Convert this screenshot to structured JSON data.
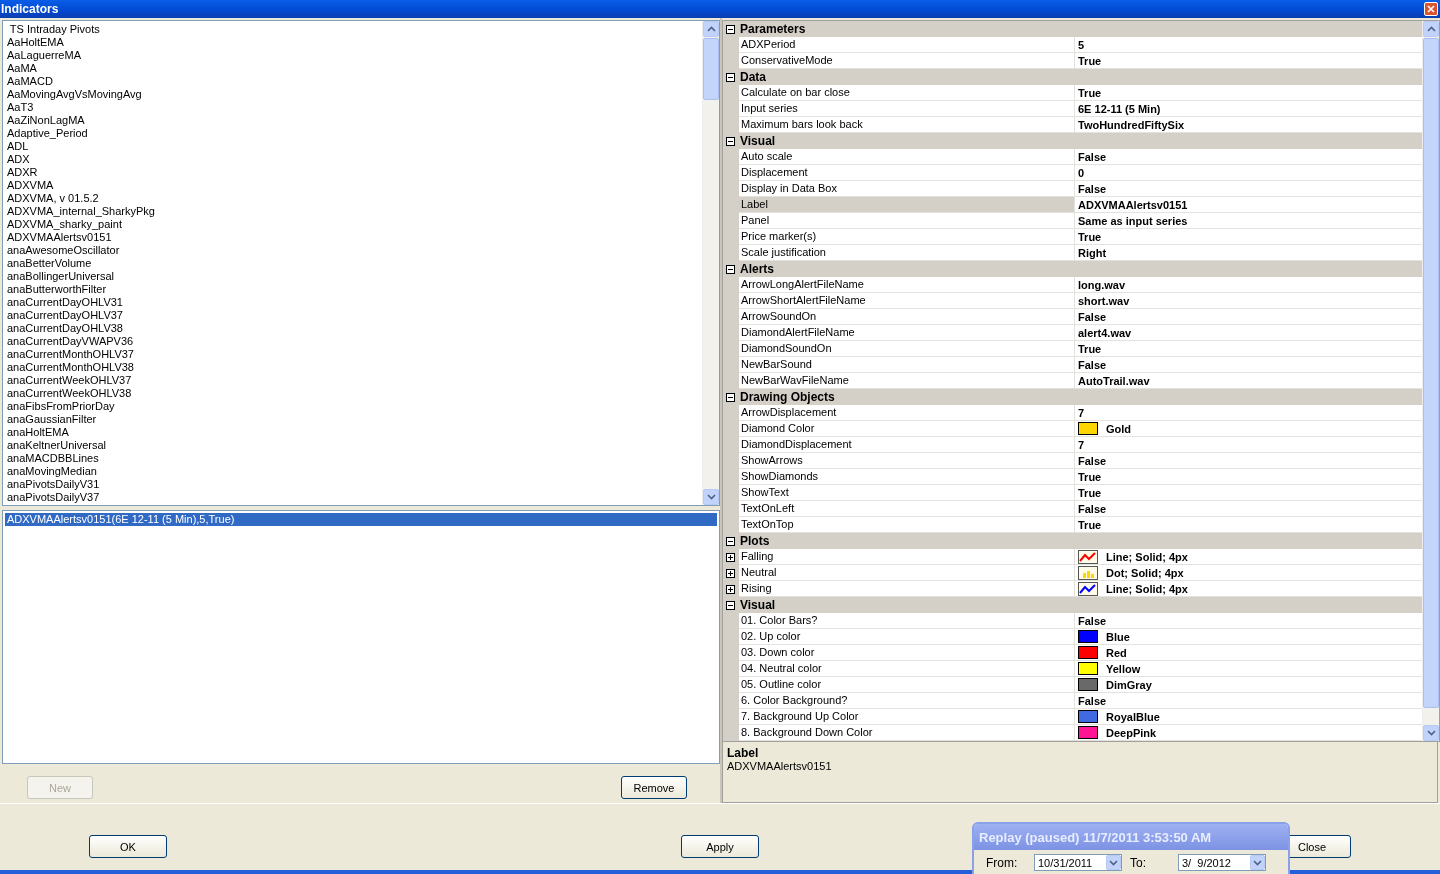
{
  "window": {
    "title": "Indicators"
  },
  "indicator_list": {
    "items": [
      " TS Intraday Pivots",
      "AaHoltEMA",
      "AaLaguerreMA",
      "AaMA",
      "AaMACD",
      "AaMovingAvgVsMovingAvg",
      "AaT3",
      "AaZiNonLagMA",
      "Adaptive_Period",
      "ADL",
      "ADX",
      "ADXR",
      "ADXVMA",
      "ADXVMA, v 01.5.2",
      "ADXVMA_internal_SharkyPkg",
      "ADXVMA_sharky_paint",
      "ADXVMAAlertsv0151",
      "anaAwesomeOscillator",
      "anaBetterVolume",
      "anaBollingerUniversal",
      "anaButterworthFilter",
      "anaCurrentDayOHLV31",
      "anaCurrentDayOHLV37",
      "anaCurrentDayOHLV38",
      "anaCurrentDayVWAPV36",
      "anaCurrentMonthOHLV37",
      "anaCurrentMonthOHLV38",
      "anaCurrentWeekOHLV37",
      "anaCurrentWeekOHLV38",
      "anaFibsFromPriorDay",
      "anaGaussianFilter",
      "anaHoltEMA",
      "anaKeltnerUniversal",
      "anaMACDBBLines",
      "anaMovingMedian",
      "anaPivotsDailyV31",
      "anaPivotsDailyV37"
    ]
  },
  "configured_list": {
    "items": [
      {
        "label": "ADXVMAAlertsv0151(6E 12-11 (5 Min),5,True)",
        "selected": true
      }
    ]
  },
  "list_buttons": [
    {
      "label": "New",
      "disabled": true
    },
    {
      "label": "Remove",
      "disabled": false
    }
  ],
  "properties": {
    "categories": [
      {
        "name": "Parameters",
        "expanded": true,
        "rows": [
          {
            "kind": "text",
            "name": "ADXPeriod",
            "value": "5",
            "selected": false
          },
          {
            "kind": "text",
            "name": "ConservativeMode",
            "value": "True",
            "selected": false
          }
        ]
      },
      {
        "name": "Data",
        "expanded": true,
        "rows": [
          {
            "kind": "text",
            "name": "Calculate on bar close",
            "value": "True",
            "selected": false
          },
          {
            "kind": "text",
            "name": "Input series",
            "value": "6E 12-11 (5 Min)",
            "selected": false
          },
          {
            "kind": "text",
            "name": "Maximum bars look back",
            "value": "TwoHundredFiftySix",
            "selected": false
          }
        ]
      },
      {
        "name": "Visual",
        "expanded": true,
        "rows": [
          {
            "kind": "text",
            "name": "Auto scale",
            "value": "False",
            "selected": false
          },
          {
            "kind": "text",
            "name": "Displacement",
            "value": "0",
            "selected": false
          },
          {
            "kind": "text",
            "name": "Display in Data Box",
            "value": "False",
            "selected": false
          },
          {
            "kind": "text",
            "name": "Label",
            "value": "ADXVMAAlertsv0151",
            "selected": true
          },
          {
            "kind": "text",
            "name": "Panel",
            "value": "Same as input series",
            "selected": false
          },
          {
            "kind": "text",
            "name": "Price marker(s)",
            "value": "True",
            "selected": false
          },
          {
            "kind": "text",
            "name": "Scale justification",
            "value": "Right",
            "selected": false
          }
        ]
      },
      {
        "name": "Alerts",
        "expanded": true,
        "rows": [
          {
            "kind": "text",
            "name": "ArrowLongAlertFileName",
            "value": "long.wav",
            "selected": false
          },
          {
            "kind": "text",
            "name": "ArrowShortAlertFileName",
            "value": "short.wav",
            "selected": false
          },
          {
            "kind": "text",
            "name": "ArrowSoundOn",
            "value": "False",
            "selected": false
          },
          {
            "kind": "text",
            "name": "DiamondAlertFileName",
            "value": "alert4.wav",
            "selected": false
          },
          {
            "kind": "text",
            "name": "DiamondSoundOn",
            "value": "True",
            "selected": false
          },
          {
            "kind": "text",
            "name": "NewBarSound",
            "value": "False",
            "selected": false
          },
          {
            "kind": "text",
            "name": "NewBarWavFileName",
            "value": "AutoTrail.wav",
            "selected": false
          }
        ]
      },
      {
        "name": "Drawing Objects",
        "expanded": true,
        "rows": [
          {
            "kind": "text",
            "name": "ArrowDisplacement",
            "value": "7",
            "selected": false
          },
          {
            "kind": "color",
            "name": "Diamond Color",
            "value": "Gold",
            "color": "#ffd700",
            "selected": false
          },
          {
            "kind": "text",
            "name": "DiamondDisplacement",
            "value": "7",
            "selected": false
          },
          {
            "kind": "text",
            "name": "ShowArrows",
            "value": "False",
            "selected": false
          },
          {
            "kind": "text",
            "name": "ShowDiamonds",
            "value": "True",
            "selected": false
          },
          {
            "kind": "text",
            "name": "ShowText",
            "value": "True",
            "selected": false
          },
          {
            "kind": "text",
            "name": "TextOnLeft",
            "value": "False",
            "selected": false
          },
          {
            "kind": "text",
            "name": "TextOnTop",
            "value": "True",
            "selected": false
          }
        ]
      },
      {
        "name": "Plots",
        "expanded": true,
        "rows": [
          {
            "kind": "line_plot",
            "name": "Falling",
            "value": "Line; Solid; 4px",
            "color": "#ff0000",
            "expanded": false,
            "selected": false
          },
          {
            "kind": "dot_plot",
            "name": "Neutral",
            "value": "Dot; Solid; 4px",
            "color": "#ffd700",
            "expanded": false,
            "selected": false
          },
          {
            "kind": "line_plot",
            "name": "Rising",
            "value": "Line; Solid; 4px",
            "color": "#0000ff",
            "expanded": false,
            "selected": false
          }
        ]
      },
      {
        "name": "Visual",
        "expanded": true,
        "rows": [
          {
            "kind": "text",
            "name": "01. Color Bars?",
            "value": "False",
            "selected": false
          },
          {
            "kind": "color",
            "name": "02. Up color",
            "value": "Blue",
            "color": "#0000ff",
            "selected": false
          },
          {
            "kind": "color",
            "name": "03. Down color",
            "value": "Red",
            "color": "#ff0000",
            "selected": false
          },
          {
            "kind": "color",
            "name": "04. Neutral color",
            "value": "Yellow",
            "color": "#ffff00",
            "selected": false
          },
          {
            "kind": "color",
            "name": "05. Outline color",
            "value": "DimGray",
            "color": "#696969",
            "selected": false
          },
          {
            "kind": "text",
            "name": "6. Color Background?",
            "value": "False",
            "selected": false
          },
          {
            "kind": "color",
            "name": "7. Background Up Color",
            "value": "RoyalBlue",
            "color": "#4169e1",
            "selected": false
          },
          {
            "kind": "color",
            "name": "8. Background Down Color",
            "value": "DeepPink",
            "color": "#ff1493",
            "selected": false
          }
        ]
      }
    ]
  },
  "description": {
    "title": "Label",
    "text": "ADXVMAAlertsv0151"
  },
  "dialog_buttons": [
    "OK",
    "Apply",
    "Close"
  ],
  "replay_window": {
    "title": "Replay (paused) 11/7/2011 3:53:50 AM",
    "from_label": "From:",
    "from_value": "10/31/2011",
    "to_label": "To:",
    "to_value": "3/  9/2012"
  }
}
